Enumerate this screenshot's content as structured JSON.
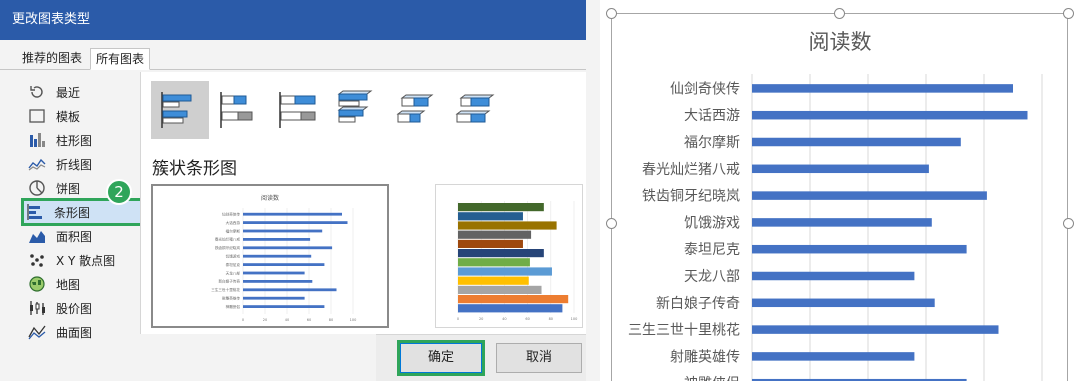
{
  "dialog": {
    "title": "更改图表类型",
    "tabs": [
      {
        "label": "推荐的图表",
        "active": false
      },
      {
        "label": "所有图表",
        "active": true
      }
    ],
    "sidebar": {
      "items": [
        {
          "label": "最近",
          "icon": "recent-icon"
        },
        {
          "label": "模板",
          "icon": "template-icon"
        },
        {
          "label": "柱形图",
          "icon": "column-chart-icon"
        },
        {
          "label": "折线图",
          "icon": "line-chart-icon"
        },
        {
          "label": "饼图",
          "icon": "pie-chart-icon"
        },
        {
          "label": "条形图",
          "icon": "bar-chart-icon",
          "selected": true
        },
        {
          "label": "面积图",
          "icon": "area-chart-icon"
        },
        {
          "label": "X Y 散点图",
          "icon": "scatter-chart-icon"
        },
        {
          "label": "地图",
          "icon": "map-chart-icon"
        },
        {
          "label": "股价图",
          "icon": "stock-chart-icon"
        },
        {
          "label": "曲面图",
          "icon": "surface-chart-icon"
        }
      ]
    },
    "step_badge": "2",
    "subtype_title": "簇状条形图",
    "subtypes": [
      {
        "name": "clustered-bar",
        "selected": true
      },
      {
        "name": "stacked-bar"
      },
      {
        "name": "100-stacked-bar"
      },
      {
        "name": "3d-clustered-bar"
      },
      {
        "name": "3d-stacked-bar"
      },
      {
        "name": "3d-100-stacked-bar"
      }
    ],
    "preview1_title": "阅读数",
    "buttons": {
      "ok": "确定",
      "cancel": "取消"
    }
  },
  "colors": {
    "title_bar": "#2b5ba9",
    "highlight": "#2fa55a",
    "bar": "#4472c4",
    "selected_item": "#cfe2f5"
  },
  "chart_data": {
    "type": "bar",
    "title": "阅读数",
    "categories": [
      "仙剑奇侠传",
      "大话西游",
      "福尔摩斯",
      "春光灿烂猪八戒",
      "铁齿铜牙纪晓岚",
      "饥饿游戏",
      "泰坦尼克",
      "天龙八部",
      "新白娘子传奇",
      "三生三世十里桃花",
      "射雕英雄传",
      "神雕侠侣"
    ],
    "values": [
      90,
      95,
      72,
      61,
      81,
      62,
      74,
      56,
      63,
      85,
      56,
      74
    ],
    "xlim": [
      0,
      100
    ],
    "grid": true
  }
}
